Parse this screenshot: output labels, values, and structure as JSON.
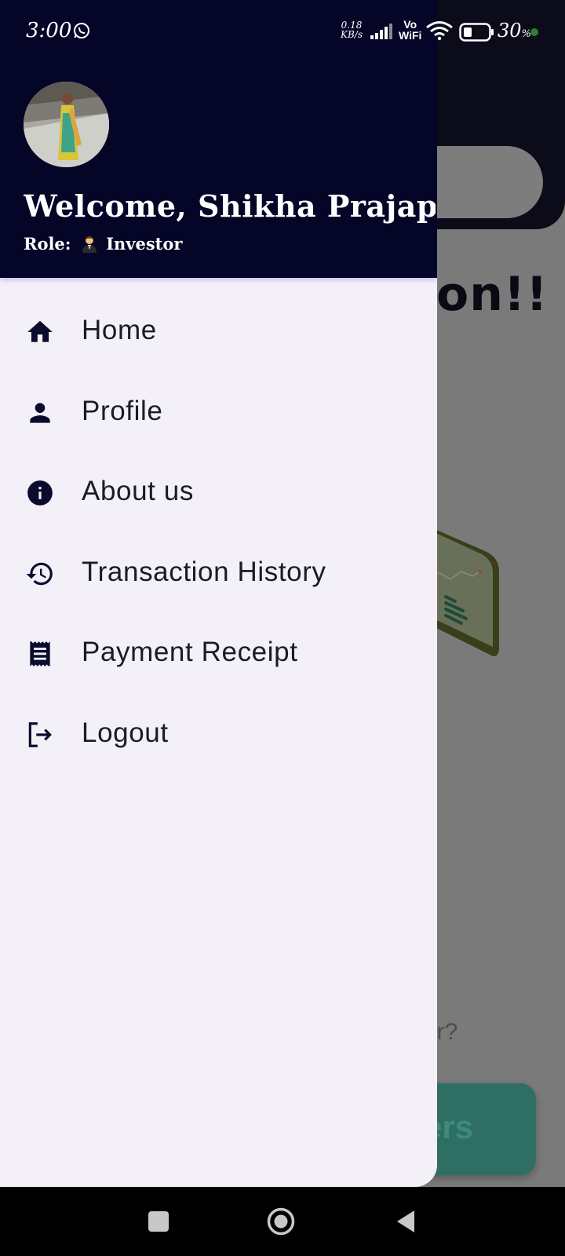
{
  "status_bar": {
    "time": "3:00",
    "speed_value": "0.18",
    "speed_unit": "KB/s",
    "vo_label": "Vo",
    "wifi_label": "WiFi",
    "battery_percent": "30",
    "battery_percent_sign": "%",
    "icons": [
      "whatsapp-icon",
      "signal-icon",
      "wifi-icon",
      "battery-icon"
    ]
  },
  "drawer": {
    "welcome_text": "Welcome, Shikha Prajap",
    "role_label": "Role:",
    "role_value": "Investor",
    "menu": [
      {
        "label": "Home",
        "icon": "home-icon"
      },
      {
        "label": "Profile",
        "icon": "person-icon"
      },
      {
        "label": "About us",
        "icon": "info-icon"
      },
      {
        "label": "Transaction History",
        "icon": "history-icon"
      },
      {
        "label": "Payment Receipt",
        "icon": "receipt-icon"
      },
      {
        "label": "Logout",
        "icon": "logout-icon"
      }
    ]
  },
  "background_app": {
    "heading_fragment": "on!!",
    "question_fragment": "er?",
    "button_fragment": "ers"
  },
  "colors": {
    "drawer_header": "#050528",
    "drawer_body": "#f4f0f8",
    "scrim": "#7a7a7a",
    "button_green": "#2f6f63"
  },
  "nav_bar": {
    "icons": [
      "recents-icon",
      "home-circle-icon",
      "back-icon"
    ]
  }
}
